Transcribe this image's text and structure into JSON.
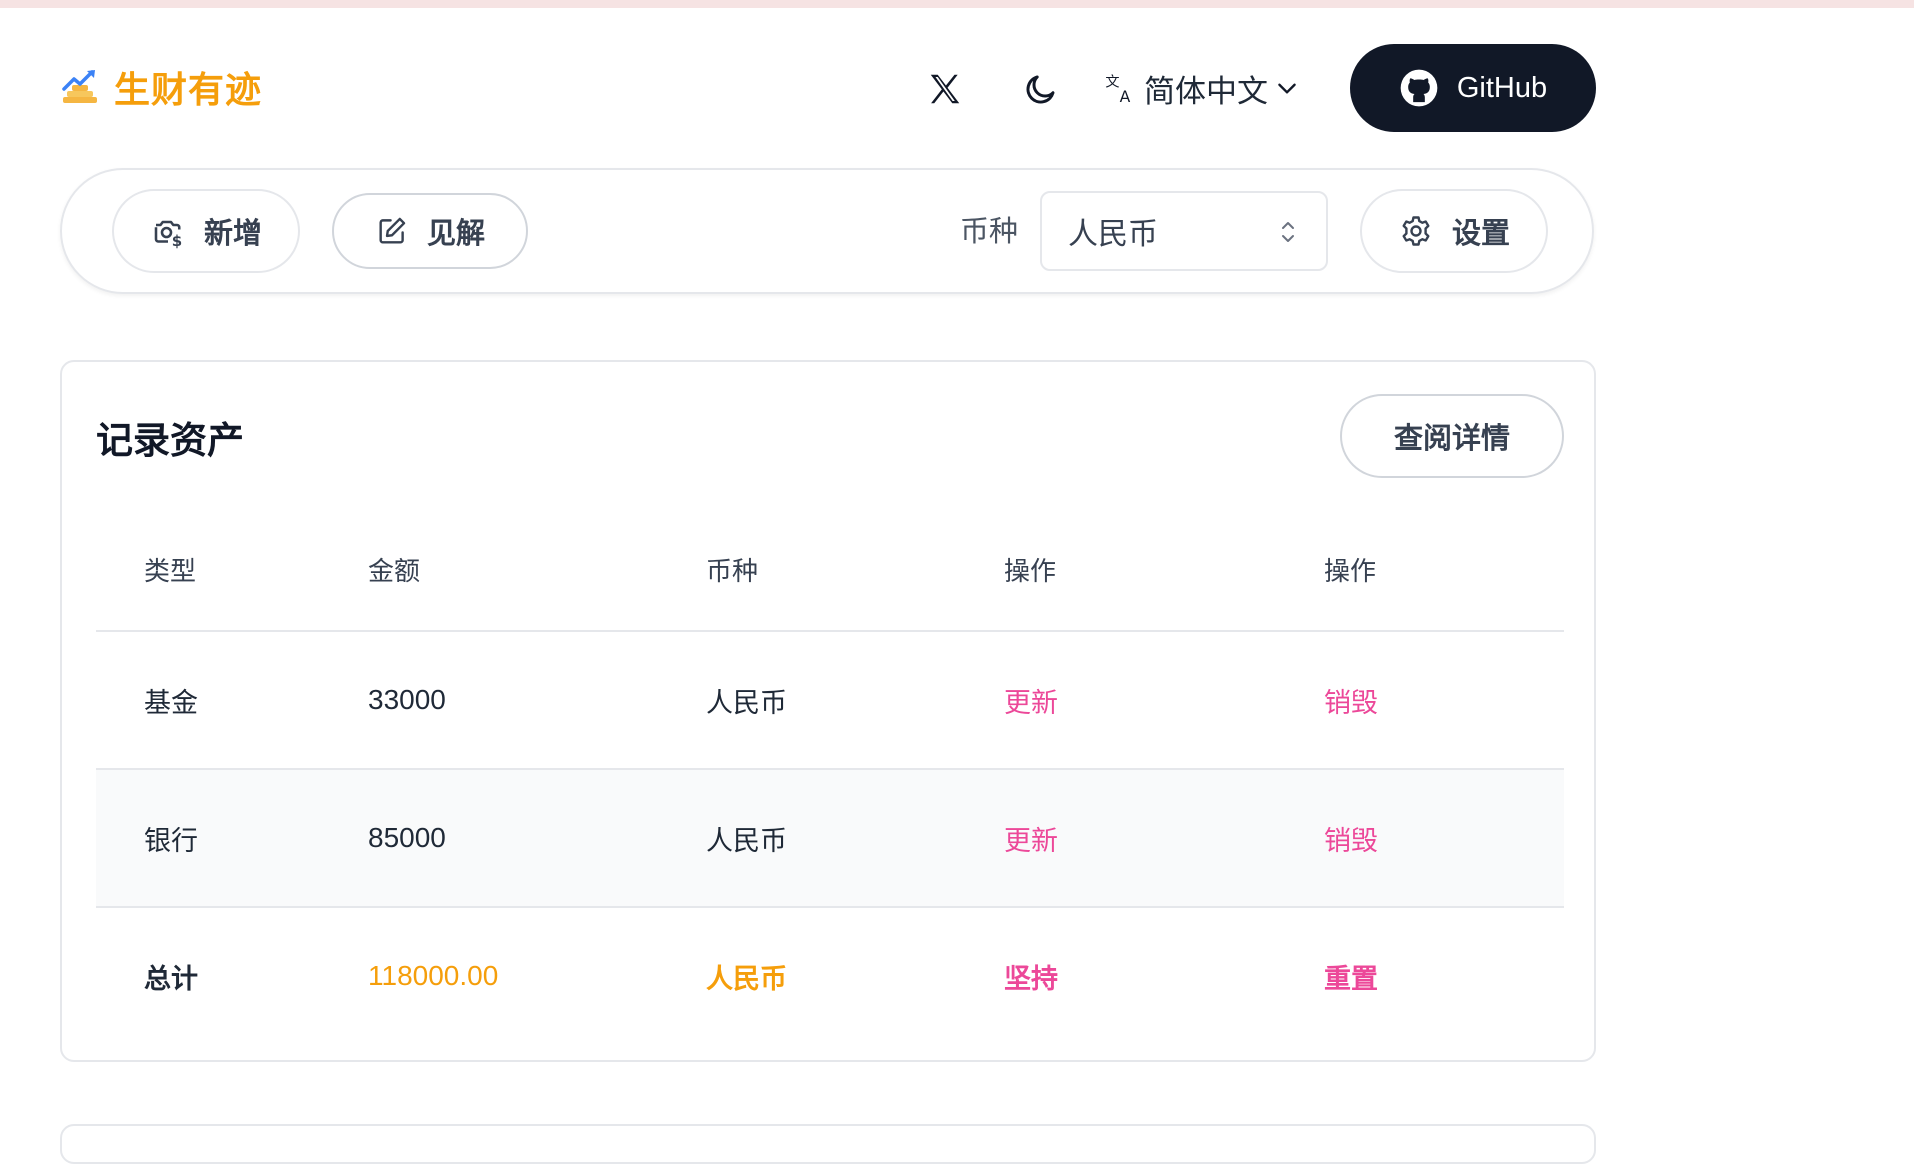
{
  "header": {
    "logo_text": "生财有迹",
    "language": "简体中文",
    "github_label": "GitHub"
  },
  "toolbar": {
    "add_label": "新增",
    "insight_label": "见解",
    "currency_label": "币种",
    "currency_value": "人民币",
    "settings_label": "设置"
  },
  "card": {
    "title": "记录资产",
    "detail_button": "查阅详情",
    "columns": [
      "类型",
      "金额",
      "币种",
      "操作",
      "操作"
    ],
    "rows": [
      {
        "type": "基金",
        "amount": "33000",
        "currency": "人民币",
        "action1": "更新",
        "action2": "销毁"
      },
      {
        "type": "银行",
        "amount": "85000",
        "currency": "人民币",
        "action1": "更新",
        "action2": "销毁"
      }
    ],
    "total": {
      "type": "总计",
      "amount": "118000.00",
      "currency": "人民币",
      "action1": "坚持",
      "action2": "重置"
    }
  },
  "colors": {
    "accent": "#f59e0b",
    "action": "#ec4899",
    "github_bg": "#111827"
  }
}
